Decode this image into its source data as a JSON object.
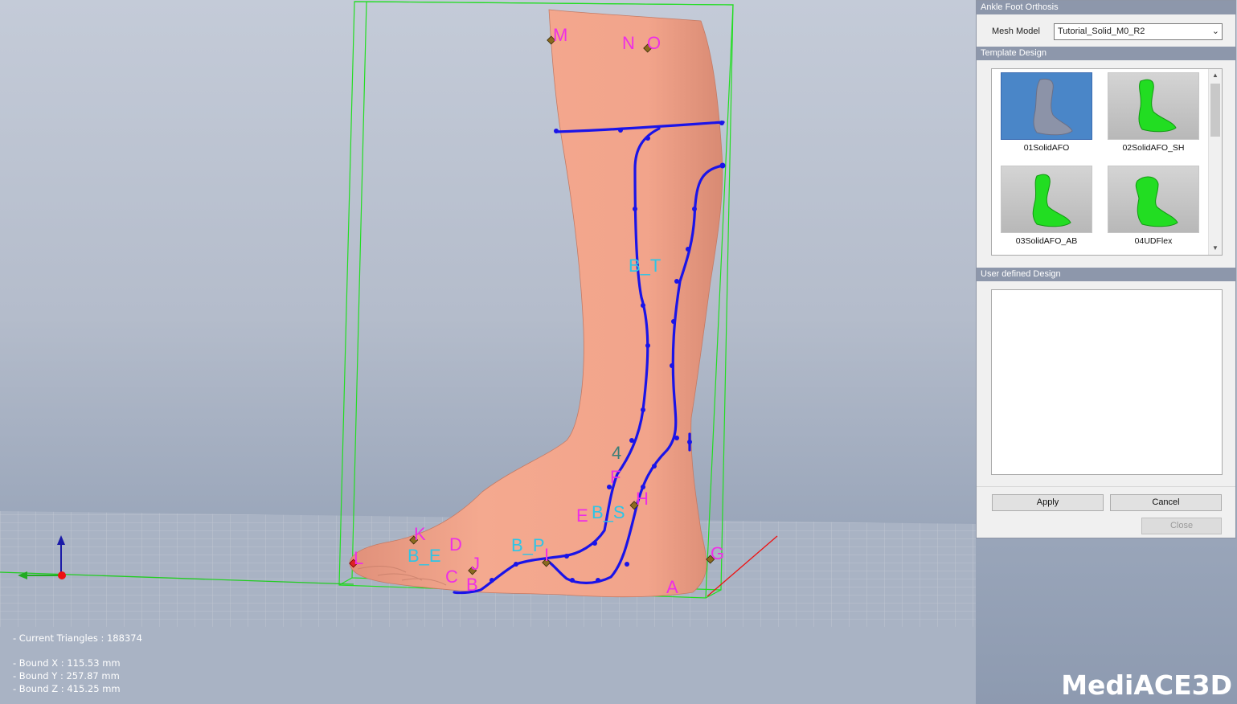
{
  "viewport": {
    "landmarks": {
      "M": "M",
      "N": "N",
      "O": "O",
      "B_T": "B_T",
      "four": "4",
      "F": "F",
      "H": "H",
      "E": "E",
      "B_S": "B_S",
      "K": "K",
      "D": "D",
      "B_E": "B_E",
      "L": "L",
      "J": "J",
      "B_P": "B_P",
      "I": "I",
      "C": "C",
      "B": "B",
      "A": "A",
      "G": "G"
    },
    "info": {
      "triangles": "- Current Triangles : 188374",
      "bound_x": "- Bound X : 115.53 mm",
      "bound_y": "- Bound Y : 257.87 mm",
      "bound_z": "- Bound Z : 415.25 mm"
    },
    "logo": "MediACE3D",
    "colors": {
      "skin": "#f0a48c",
      "curve": "#1a14e8",
      "bbox": "#22dd22",
      "magenta": "#ee2ee6",
      "cyan": "#2dc5e6"
    }
  },
  "panel": {
    "title": "Ankle Foot Orthosis",
    "mesh_model_label": "Mesh Model",
    "mesh_model_value": "Tutorial_Solid_M0_R2",
    "template_design_header": "Template Design",
    "templates": [
      {
        "label": "01SolidAFO",
        "selected": true
      },
      {
        "label": "02SolidAFO_SH",
        "selected": false
      },
      {
        "label": "03SolidAFO_AB",
        "selected": false
      },
      {
        "label": "04UDFlex",
        "selected": false
      }
    ],
    "user_defined_header": "User defined Design",
    "apply": "Apply",
    "cancel": "Cancel",
    "close": "Close"
  }
}
